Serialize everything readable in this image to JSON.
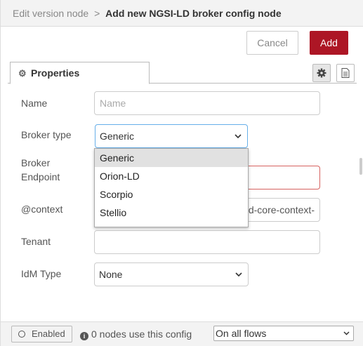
{
  "header": {
    "breadcrumb_parent": "Edit version node",
    "breadcrumb_sep": ">",
    "title": "Add new NGSI-LD broker config node"
  },
  "actions": {
    "cancel_label": "Cancel",
    "add_label": "Add",
    "accent_color": "#ad1625"
  },
  "tabs": {
    "properties_label": "Properties",
    "properties_icon": "gear-icon",
    "side_tabs": [
      "gear-icon",
      "document-icon"
    ]
  },
  "form": {
    "name": {
      "label": "Name",
      "placeholder": "Name",
      "value": ""
    },
    "broker_type": {
      "label": "Broker type",
      "value": "Generic",
      "options": [
        "Generic",
        "Orion-LD",
        "Scorpio",
        "Stellio"
      ],
      "highlighted": "Generic"
    },
    "broker_endpoint": {
      "label_line1": "Broker",
      "label_line2": "Endpoint",
      "value": ""
    },
    "context": {
      "label": "@context",
      "value": "d-core-context-"
    },
    "tenant": {
      "label": "Tenant",
      "value": ""
    },
    "idm_type": {
      "label": "IdM Type",
      "value": "None"
    }
  },
  "footer": {
    "enabled_label": "Enabled",
    "usage_text": "0 nodes use this config",
    "scope_value": "On all flows"
  }
}
